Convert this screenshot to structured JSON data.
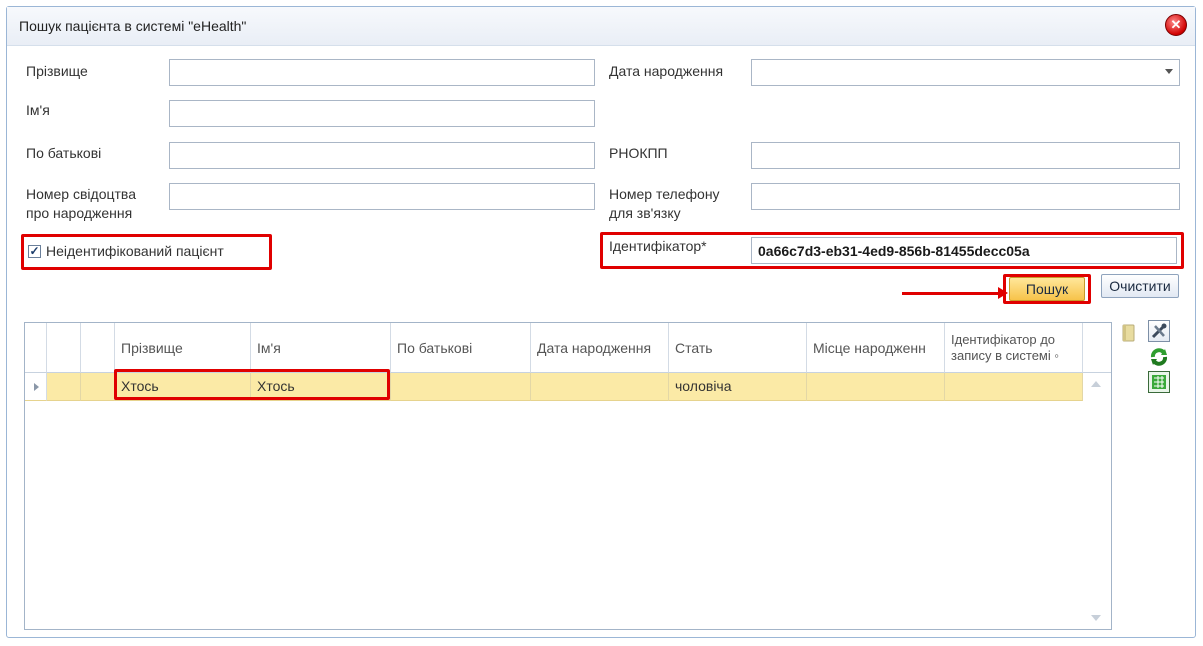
{
  "window": {
    "title": "Пошук пацієнта в системі \"eHealth\"",
    "close_glyph": "✕"
  },
  "form": {
    "surname_label": "Прізвище",
    "name_label": "Ім'я",
    "patronymic_label": "По батькові",
    "birth_cert_label_1": "Номер свідоцтва",
    "birth_cert_label_2": "про народження",
    "birth_date_label": "Дата народження",
    "rnokpp_label": "РНОКПП",
    "phone_label_1": "Номер телефону",
    "phone_label_2": "для зв'язку",
    "unidentified_label": "Неідентифікований пацієнт",
    "unidentified_checked": true,
    "identifier_label": "Ідентифікатор*",
    "identifier_value": "0a66c7d3-eb31-4ed9-856b-81455decc05a",
    "search_button": "Пошук",
    "clear_button": "Очистити"
  },
  "grid": {
    "columns": [
      "Прізвище",
      "Ім'я",
      "По батькові",
      "Дата народження",
      "Стать",
      "Місце народженн",
      "Ідентифікатор до",
      "запису в системі ◦"
    ],
    "rows": [
      {
        "surname": "Хтось",
        "name": "Хтось",
        "patronymic": "",
        "birth_date": "",
        "sex": "чоловіча",
        "birth_place": "",
        "record_id": ""
      }
    ]
  },
  "colors": {
    "highlight": "#e00000",
    "selected_row": "#fbeaa6",
    "search_button": "#f7c34a"
  },
  "toolbar_icons": [
    "book-icon",
    "tools-icon",
    "refresh-icon",
    "excel-export-icon"
  ]
}
